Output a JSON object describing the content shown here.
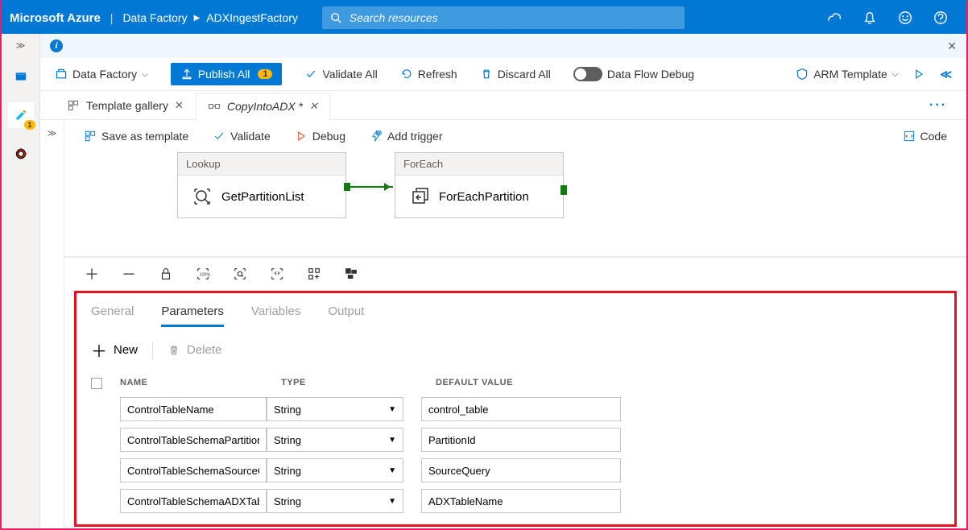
{
  "header": {
    "brand": "Microsoft Azure",
    "breadcrumb1": "Data Factory",
    "breadcrumb2": "ADXIngestFactory",
    "search_placeholder": "Search resources"
  },
  "leftrail": {
    "badge": "1"
  },
  "cmdbar": {
    "factory": "Data Factory",
    "publish": "Publish All",
    "publish_count": "1",
    "validate_all": "Validate All",
    "refresh": "Refresh",
    "discard": "Discard All",
    "dataflow": "Data Flow Debug",
    "arm": "ARM Template"
  },
  "tabs": {
    "t1": "Template gallery",
    "t2": "CopyIntoADX *"
  },
  "toolbar2": {
    "save": "Save as template",
    "validate": "Validate",
    "debug": "Debug",
    "trigger": "Add trigger",
    "code": "Code"
  },
  "nodes": {
    "n1_head": "Lookup",
    "n1_body": "GetPartitionList",
    "n2_head": "ForEach",
    "n2_body": "ForEachPartition"
  },
  "proptabs": {
    "general": "General",
    "params": "Parameters",
    "vars": "Variables",
    "output": "Output"
  },
  "listbar": {
    "new": "New",
    "delete": "Delete"
  },
  "gridhead": {
    "name": "NAME",
    "type": "TYPE",
    "default": "DEFAULT VALUE"
  },
  "params": [
    {
      "name": "ControlTableName",
      "type": "String",
      "default": "control_table"
    },
    {
      "name": "ControlTableSchemaPartition",
      "type": "String",
      "default": "PartitionId"
    },
    {
      "name": "ControlTableSchemaSourceQ",
      "type": "String",
      "default": "SourceQuery"
    },
    {
      "name": "ControlTableSchemaADXTabl",
      "type": "String",
      "default": "ADXTableName"
    }
  ]
}
